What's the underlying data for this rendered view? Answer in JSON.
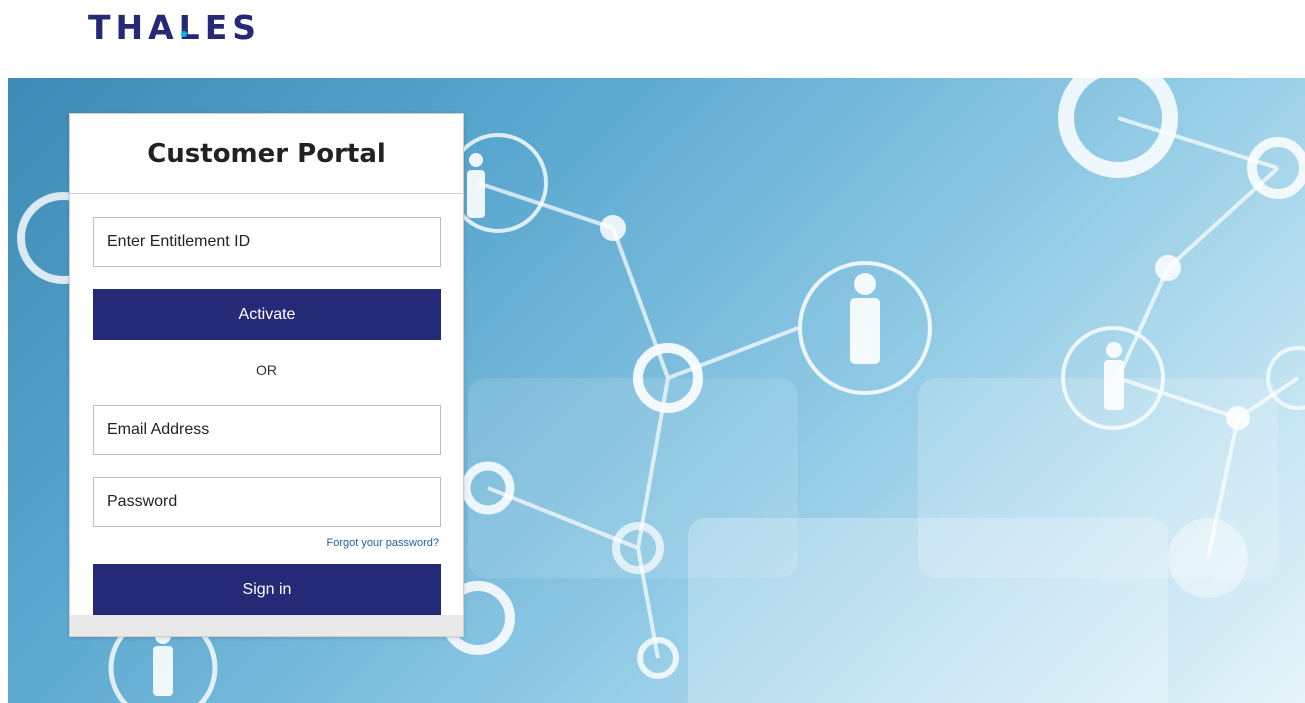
{
  "brand": {
    "logo_text": "THALES",
    "color": "#242a75",
    "accent": "#00bbdd"
  },
  "login_card": {
    "title": "Customer Portal",
    "entitlement": {
      "placeholder": "Enter Entitlement ID",
      "value": ""
    },
    "activate_label": "Activate",
    "separator": "OR",
    "email": {
      "placeholder": "Email Address",
      "value": ""
    },
    "password": {
      "placeholder": "Password",
      "value": ""
    },
    "forgot_label": "Forgot your password?",
    "signin_label": "Sign in",
    "button_color": "#242a75"
  },
  "hero": {
    "image_description_icon": "network-people-background"
  }
}
